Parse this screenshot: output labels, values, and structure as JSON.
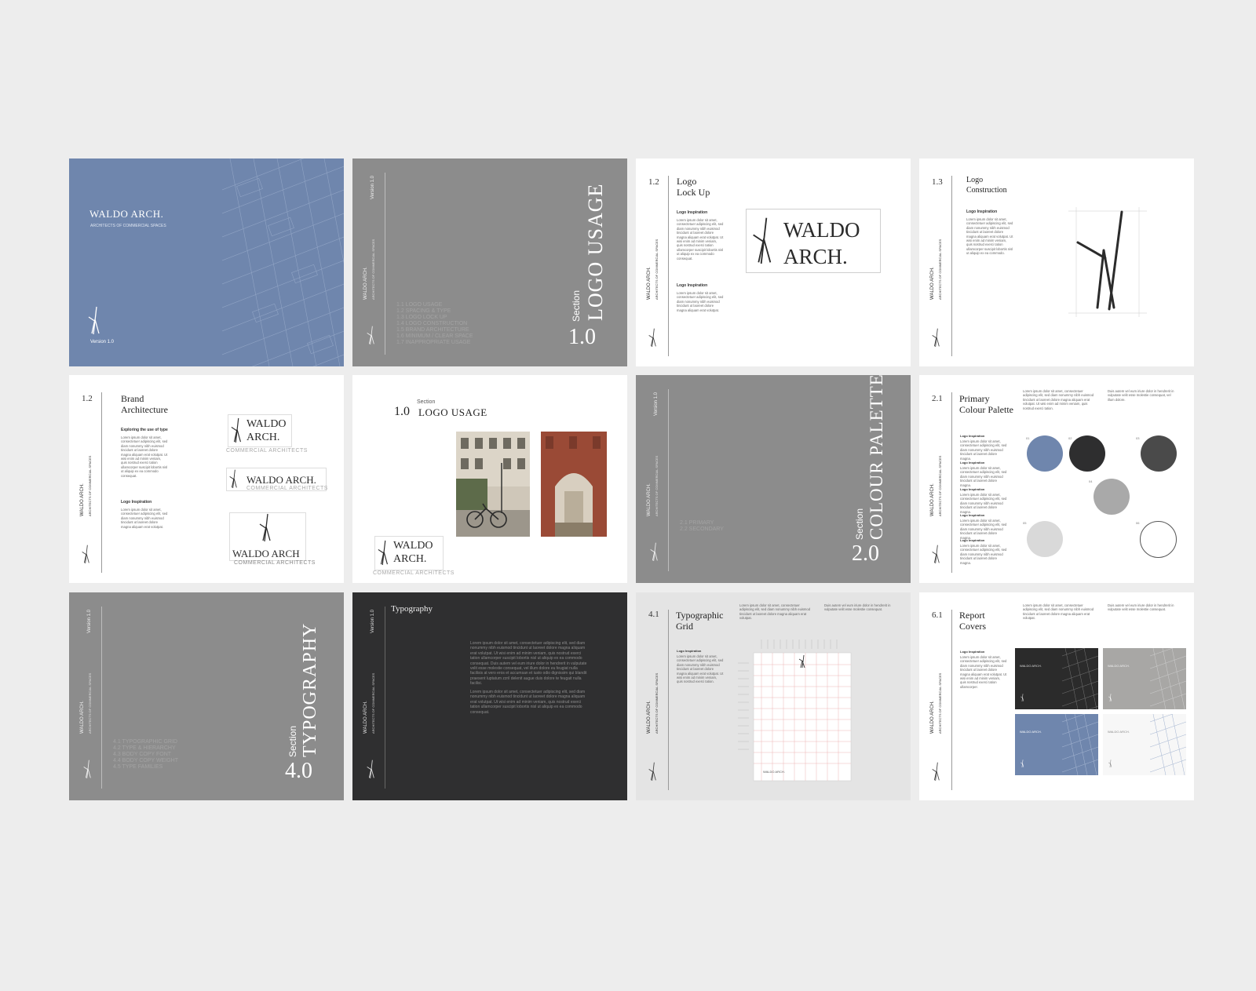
{
  "brand": {
    "name": "WALDO ARCH.",
    "name_alt": "WALDO ARCH",
    "tagline": "ARCHITECTS OF COMMERCIAL SPACES",
    "tagline_short": "COMMERCIAL ARCHITECTS",
    "word1": "WALDO",
    "word2": "ARCH.",
    "version": "Version 1.0"
  },
  "pages": {
    "cover": {
      "title": "WALDO ARCH.",
      "tagline": "ARCHITECTS OF COMMERCIAL SPACES",
      "version": "Version 1.0"
    },
    "section1": {
      "section_word": "Section",
      "title": "LOGO USAGE",
      "number": "1.0",
      "toc": [
        "1.1   LOGO USAGE",
        "1.2   SPACING & TYPE",
        "1.3   LOGO LOCK UP",
        "1.4   LOGO CONSTRUCTION",
        "1.5   BRAND ARCHITECTURE",
        "1.6   MINIMUM / CLEAR SPACE",
        "1.7   INAPPROPRIATE USAGE"
      ]
    },
    "lockup": {
      "number": "1.2",
      "title1": "Logo",
      "title2": "Lock Up",
      "sub1": "Logo Inspiration",
      "body1": "Lorem ipsum dolor sit amet, consectetuer adipiscing elit, sed diam nonummy nibh euismod tincidunt ut laoreet dolore magna aliquam erat volutpat. Ut wisi enim ad minim veniam, quis nostrud exerci tation ullamcorper suscipit lobortis nisl ut aliquip ex ea commodo consequat.",
      "sub2": "Logo Inspiration",
      "body2": "Lorem ipsum dolor sit amet, consectetuer adipiscing elit, sed diam nonummy nibh euismod tincidunt ut laoreet dolore magna aliquam erat volutpat."
    },
    "construction": {
      "number": "1.3",
      "title1": "Logo",
      "title2": "Construction",
      "sub1": "Logo Inspiration",
      "body1": "Lorem ipsum dolor sit amet, consectetuer adipiscing elit, sed diam nonummy nibh euismod tincidunt ut laoreet dolore magna aliquam erat volutpat. Ut wisi enim ad minim veniam, quis nostrud exerci tation ullamcorper suscipit lobortis nisl ut aliquip ex ea commodo."
    },
    "architecture": {
      "number": "1.2",
      "title1": "Brand",
      "title2": "Architecture",
      "sub1": "Exploring the use of type",
      "body1": "Lorem ipsum dolor sit amet, consectetuer adipiscing elit, sed diam nonummy nibh euismod tincidunt ut laoreet dolore magna aliquam erat volutpat. Ut wisi enim ad minim veniam, quis nostrud exerci tation ullamcorper suscipit lobortis nisl ut aliquip ex ea commodo consequat.",
      "sub2": "Logo Inspiration",
      "body2": "Lorem ipsum dolor sit amet, consectetuer adipiscing elit, sed diam nonummy nibh euismod tincidunt ut laoreet dolore magna aliquam erat volutpat."
    },
    "usage_photos": {
      "section_word": "Section",
      "number": "1.0",
      "title": "LOGO USAGE"
    },
    "section2": {
      "section_word": "Section",
      "title": "COLOUR PALETTE",
      "number": "2.0",
      "toc": [
        "2.1   PRIMARY",
        "2.2   SECONDARY"
      ]
    },
    "palette": {
      "number": "2.1",
      "title1": "Primary",
      "title2": "Colour Palette",
      "intro1": "Lorem ipsum dolor sit amet, consectetuer adipiscing elit, sed diam nonummy nibh euismod tincidunt ut laoreet dolore magna aliquam erat volutpat. Ut wisi enim ad minim veniam, quis nostrud exerci tation.",
      "intro2": "Duis autem vel eum iriure dolor in hendrerit in vulputate velit esse molestie consequat, vel illum dolore.",
      "subs": [
        "Logo Inspiration",
        "Logo Inspiration",
        "Logo Inspiration",
        "Logo Inspiration",
        "Logo Inspiration"
      ],
      "body": "Lorem ipsum dolor sit amet, consectetuer adipiscing elit, sed diam nonummy nibh euismod tincidunt ut laoreet dolore magna.",
      "swatches": [
        {
          "label": "01",
          "color": "#6f86ad"
        },
        {
          "label": "02",
          "color": "#2e2e2f"
        },
        {
          "label": "03",
          "color": "#4a4a4a"
        },
        {
          "label": "04",
          "color": "#a9a9a9"
        },
        {
          "label": "05",
          "color": "#d9d9d9"
        },
        {
          "label": "06",
          "color": "#ffffff"
        }
      ]
    },
    "section4": {
      "section_word": "Section",
      "title": "TYPOGRAPHY",
      "number": "4.0",
      "toc": [
        "4.1   TYPOGRAPHIC GRID",
        "4.2   TYPE & HIERARCHY",
        "4.3   BODY COPY FONT",
        "4.4   BODY COPY WEIGHT",
        "4.5   TYPE FAMILIES"
      ]
    },
    "typography": {
      "title": "Typography",
      "body1": "Lorem ipsum dolor sit amet, consectetuer adipiscing elit, sed diam nonummy nibh euismod tincidunt ut laoreet dolore magna aliquam erat volutpat. Ut wisi enim ad minim veniam, quis nostrud exerci tation ullamcorper suscipit lobortis nisl ut aliquip ex ea commodo consequat. Duis autem vel eum iriure dolor in hendrerit in vulputate velit esse molestie consequat, vel illum dolore eu feugiat nulla facilisis at vero eros et accumsan et iusto odio dignissim qui blandit praesent luptatum zzril delenit augue duis dolore te feugait nulla facilisi.",
      "body2": "Lorem ipsum dolor sit amet, consectetuer adipiscing elit, sed diam nonummy nibh euismod tincidunt ut laoreet dolore magna aliquam erat volutpat. Ut wisi enim ad minim veniam, quis nostrud exerci tation ullamcorper suscipit lobortis nisl ut aliquip ex ea commodo consequat."
    },
    "grid": {
      "number": "4.1",
      "title1": "Typographic",
      "title2": "Grid",
      "intro1": "Lorem ipsum dolor sit amet, consectetuer adipiscing elit, sed diam nonummy nibh euismod tincidunt ut laoreet dolore magna aliquam erat volutpat.",
      "intro2": "Duis autem vel eum iriure dolor in hendrerit in vulputate velit esse molestie consequat.",
      "sub1": "Logo Inspiration",
      "body1": "Lorem ipsum dolor sit amet, consectetuer adipiscing elit, sed diam nonummy nibh euismod tincidunt ut laoreet dolore magna aliquam erat volutpat. Ut wisi enim ad minim veniam, quis nostrud exerci tation."
    },
    "covers": {
      "number": "6.1",
      "title1": "Report",
      "title2": "Covers",
      "intro1": "Lorem ipsum dolor sit amet, consectetuer adipiscing elit, sed diam nonummy nibh euismod tincidunt ut laoreet dolore magna aliquam erat volutpat.",
      "intro2": "Duis autem vel eum iriure dolor in hendrerit in vulputate velit esse molestie consequat.",
      "sub1": "Logo Inspiration",
      "body1": "Lorem ipsum dolor sit amet, consectetuer adipiscing elit, sed diam nonummy nibh euismod tincidunt ut laoreet dolore magna aliquam erat volutpat. Ut wisi enim ad minim veniam, quis nostrud exerci tation ullamcorper.",
      "cover_title": "WALDO ARCH."
    }
  }
}
